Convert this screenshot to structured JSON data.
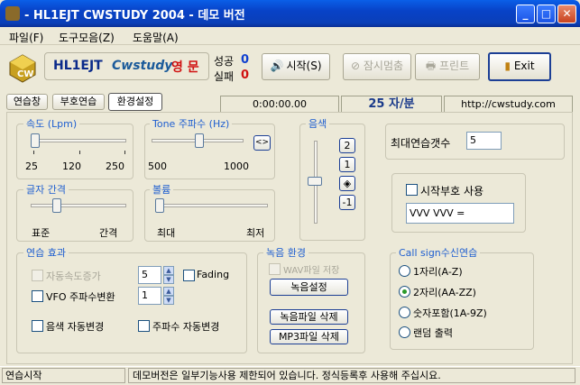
{
  "window": {
    "title": "- HL1EJT CWSTUDY 2004 - 데모 버전"
  },
  "menu": [
    "파일(F)",
    "도구모음(Z)",
    "도움말(A)"
  ],
  "toolbar": {
    "callsign": "HL1EJT",
    "app_name": "Cwstudy",
    "mode": "영 문",
    "success_label": "성공",
    "success_value": "0",
    "fail_label": "실패",
    "fail_value": "0",
    "start": "시작(S)",
    "pause": "잠시멈춤",
    "print": "프린트",
    "exit": "Exit"
  },
  "tabs": [
    "연습창",
    "부호연습",
    "환경설정"
  ],
  "info": {
    "time": "0:00:00.00",
    "speed": "25 자/분",
    "url": "http://cwstudy.com"
  },
  "speed": {
    "label": "속도 (Lpm)",
    "min": "25",
    "mid": "120",
    "max": "250",
    "value": 25
  },
  "tone": {
    "label": "Tone 주파수 (Hz)",
    "min": "500",
    "max": "1000",
    "value": 750,
    "button": "<>"
  },
  "tone_color": {
    "label": "음색",
    "options": [
      "2",
      "1",
      "◈",
      "-1"
    ]
  },
  "max_count": {
    "label": "최대연습갯수",
    "value": "5"
  },
  "spacing": {
    "label": "글자 간격",
    "left": "표준",
    "right": "간격"
  },
  "volume": {
    "label": "볼륨",
    "left": "최대",
    "right": "최저"
  },
  "start_code": {
    "label": "시작부호 사용",
    "value": "VVV VVV ="
  },
  "practice": {
    "label": "연습 효과",
    "auto_speed": "자동속도증가",
    "auto_speed_value": "5",
    "fading": "Fading",
    "vfo": "VFO 주파수변환",
    "vfo_value": "1",
    "auto_tone": "음색 자동변경",
    "auto_freq": "주파수 자동변경"
  },
  "recording": {
    "label": "녹음 환경",
    "wav_save": "WAV파일 저장",
    "settings": "녹음설정",
    "delete_rec": "녹음파일 삭제",
    "delete_mp3": "MP3파일 삭제"
  },
  "callsign_practice": {
    "label": "Call sign수신연습",
    "options": [
      "1자리(A-Z)",
      "2자리(AA-ZZ)",
      "숫자포함(1A-9Z)",
      "랜덤 출력"
    ],
    "selected": 1
  },
  "status": {
    "left": "연습시작",
    "right": "데모버전은 일부기능사용 제한되어 있습니다. 정식등록후 사용해 주십시요."
  }
}
